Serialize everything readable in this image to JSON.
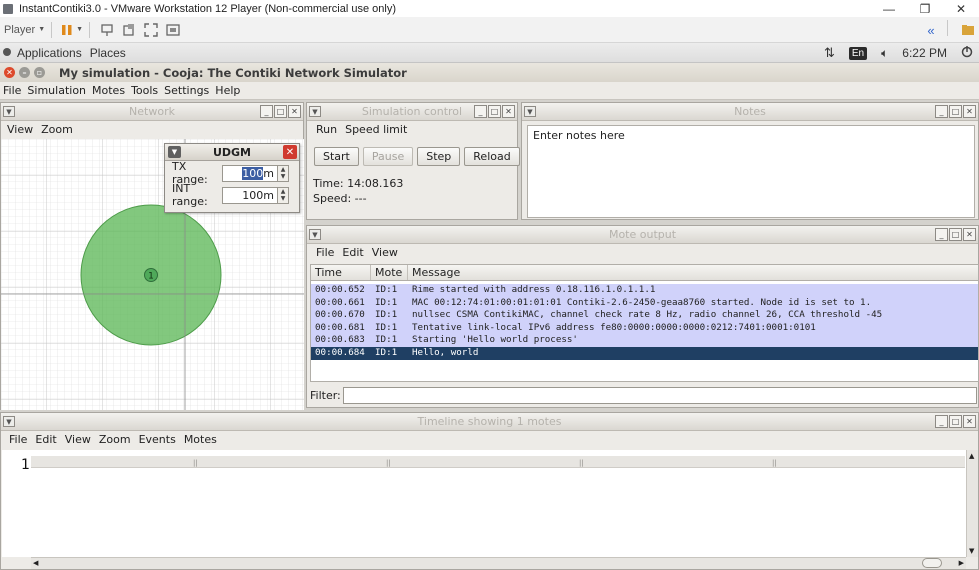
{
  "vmware": {
    "title": "InstantContiki3.0 - VMware Workstation 12 Player (Non-commercial use only)",
    "player_menu": "Player",
    "window_controls": [
      "—",
      "❐",
      "✕"
    ]
  },
  "gnome_panel": {
    "applications": "Applications",
    "places": "Places",
    "keyboard_layout": "En",
    "clock": "6:22 PM"
  },
  "cooja": {
    "window_title": "My simulation - Cooja: The Contiki Network Simulator",
    "menu": [
      "File",
      "Simulation",
      "Motes",
      "Tools",
      "Settings",
      "Help"
    ]
  },
  "network": {
    "title": "Network",
    "menu": [
      "View",
      "Zoom"
    ],
    "mote_label": "1",
    "colors": {
      "range": "#5fb85a",
      "grid": "#c9c9c9"
    }
  },
  "udgm": {
    "title": "UDGM",
    "tx_label": "TX range:",
    "tx_value_selected": "100",
    "tx_value_rest": "m",
    "int_label": "INT range:",
    "int_value": "100m"
  },
  "simulation_control": {
    "title": "Simulation control",
    "menu": [
      "Run",
      "Speed limit"
    ],
    "buttons": {
      "start": "Start",
      "pause": "Pause",
      "step": "Step",
      "reload": "Reload"
    },
    "time": "Time: 14:08.163",
    "speed": "Speed: ---"
  },
  "notes": {
    "title": "Notes",
    "text": "Enter notes here"
  },
  "mote_output": {
    "title": "Mote output",
    "menu": [
      "File",
      "Edit",
      "View"
    ],
    "columns": [
      "Time",
      "Mote",
      "Message"
    ],
    "rows": [
      {
        "time": "00:00.652",
        "mote": "ID:1",
        "message": "Rime started with address 0.18.116.1.0.1.1.1"
      },
      {
        "time": "00:00.661",
        "mote": "ID:1",
        "message": "MAC 00:12:74:01:00:01:01:01 Contiki-2.6-2450-geaa8760 started. Node id is set to 1."
      },
      {
        "time": "00:00.670",
        "mote": "ID:1",
        "message": "nullsec CSMA ContikiMAC, channel check rate 8 Hz, radio channel 26, CCA threshold -45"
      },
      {
        "time": "00:00.681",
        "mote": "ID:1",
        "message": "Tentative link-local IPv6 address fe80:0000:0000:0000:0212:7401:0001:0101"
      },
      {
        "time": "00:00.683",
        "mote": "ID:1",
        "message": "Starting 'Hello world process'"
      },
      {
        "time": "00:00.684",
        "mote": "ID:1",
        "message": "Hello, world"
      }
    ],
    "filter_label": "Filter:",
    "colors": {
      "row": "#d0d2fa",
      "selected": "#1f3f63"
    }
  },
  "timeline": {
    "title": "Timeline showing 1 motes",
    "menu": [
      "File",
      "Edit",
      "View",
      "Zoom",
      "Events",
      "Motes"
    ],
    "mote_row_label": "1"
  }
}
